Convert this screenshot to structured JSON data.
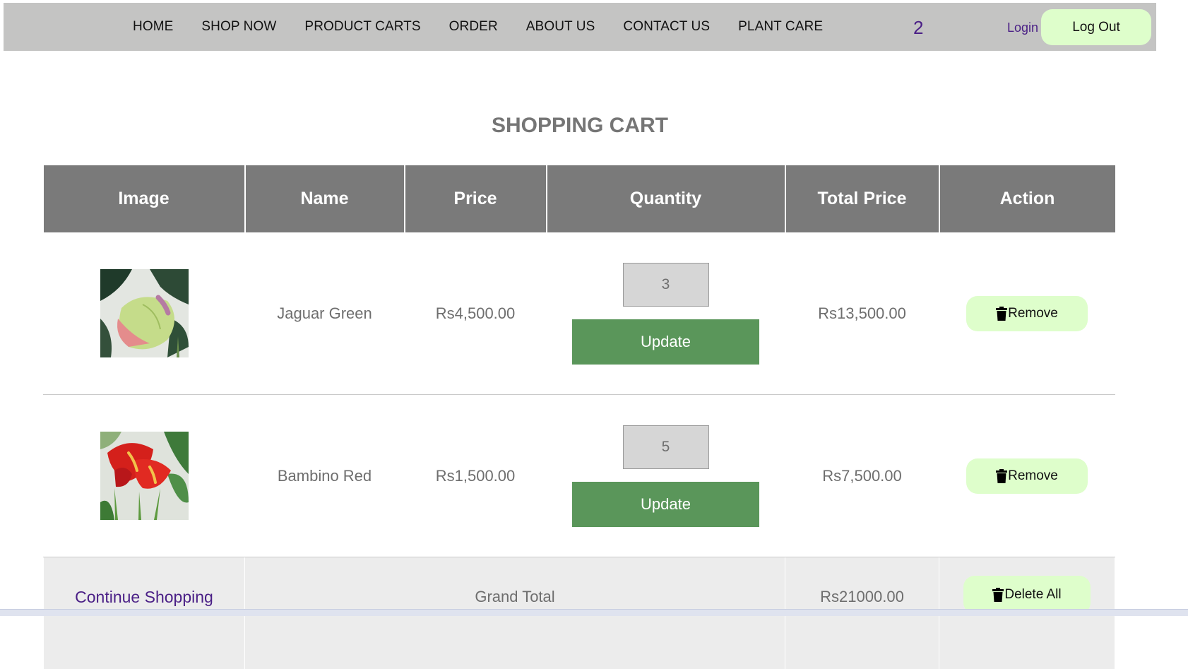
{
  "nav": {
    "links": [
      "HOME",
      "SHOP NOW",
      "PRODUCT CARTS",
      "ORDER",
      "ABOUT US",
      "CONTACT US",
      "PLANT CARE"
    ],
    "cart_count": "2",
    "login_label": "Login",
    "logout_label": "Log Out"
  },
  "page": {
    "title": "SHOPPING CART"
  },
  "table": {
    "headers": [
      "Image",
      "Name",
      "Price",
      "Quantity",
      "Total Price",
      "Action"
    ],
    "rows": [
      {
        "image_icon": "anthurium-jaguar-green-photo",
        "name": "Jaguar Green",
        "price": "Rs4,500.00",
        "quantity": "3",
        "update_label": "Update",
        "total": "Rs13,500.00",
        "remove_label": "Remove"
      },
      {
        "image_icon": "anthurium-bambino-red-photo",
        "name": "Bambino Red",
        "price": "Rs1,500.00",
        "quantity": "5",
        "update_label": "Update",
        "total": "Rs7,500.00",
        "remove_label": "Remove"
      }
    ],
    "footer": {
      "continue_label": "Continue Shopping",
      "grand_total_label": "Grand Total",
      "grand_total_value": "Rs21000.00",
      "delete_all_label": "Delete All"
    }
  },
  "colors": {
    "navbar_bg": "#c4c4c3",
    "header_bg": "#7a7a7a",
    "button_green": "#5a965a",
    "pill_bg": "#defecb",
    "link_purple": "#4a1f86"
  }
}
